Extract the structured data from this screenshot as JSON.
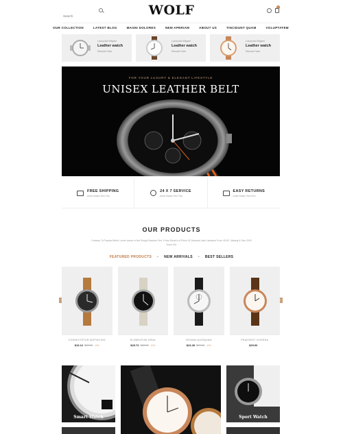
{
  "header": {
    "search_placeholder": "Search",
    "logo": "WOLF",
    "cart_count": "0"
  },
  "nav": {
    "items": [
      "OUR COLLECTION",
      "LATEST BLOG",
      "MAGNI DOLORES",
      "NEM APERIAM",
      "ABOUT US",
      "TINCIDUNT QUAM",
      "VOLUPTATEM"
    ]
  },
  "promos": [
    {
      "small": "Luxury And Elegant",
      "big": "Leather watch",
      "link": "Discover Now"
    },
    {
      "small": "Luxury And Elegant",
      "big": "Leather watch",
      "link": "Discover Now"
    },
    {
      "small": "Luxury And Elegant",
      "big": "Leather watch",
      "link": "Discover Now"
    }
  ],
  "hero": {
    "tag": "FOR YOUR LUXURY & ELEGANT LIFESTYLE",
    "title": "UNISEX LEATHER BELT"
  },
  "services": [
    {
      "title": "FREE SHIPPING",
      "sub": "Amet Sotam Tem Ficc"
    },
    {
      "title": "24 X 7 SERVICE",
      "sub": "Amet Sotam Tem Ficc"
    },
    {
      "title": "EASY RETURNS",
      "sub": "Amet Sotam Tem Ficc"
    }
  ],
  "products_section": {
    "title": "OUR PRODUCTS",
    "description": "Contrary To Popular Belief, Lorem Ipsum Is Not Simply Random Text. It Has Roots In A Piece Of Classical Latin Literature From 45 BC, Making It Over 2000 Years Old.",
    "tabs": [
      "FEATURED PRODUCTS",
      "NEW ARRIVALS",
      "BEST SELLERS"
    ],
    "active_tab": "FEATURED PRODUCTS"
  },
  "products": [
    {
      "name": "CONSECTETUR ADIPISCING",
      "price": "$19.12",
      "old_price": "$20.00",
      "discount": "-10%"
    },
    {
      "name": "ELEMENTUM URNA",
      "price": "$29.72",
      "old_price": "$33.00",
      "discount": "-10%"
    },
    {
      "name": "VENIAM QUISQUAM",
      "price": "$23.28",
      "old_price": "$25.00",
      "discount": "-10%"
    },
    {
      "name": "PRAESENT VIVERRA",
      "price": "$29.00",
      "old_price": "",
      "discount": ""
    }
  ],
  "categories": {
    "left": "Smart Watch",
    "right": "Sport Watch"
  },
  "colors": {
    "accent": "#c07840",
    "hero_bg": "#050505"
  }
}
